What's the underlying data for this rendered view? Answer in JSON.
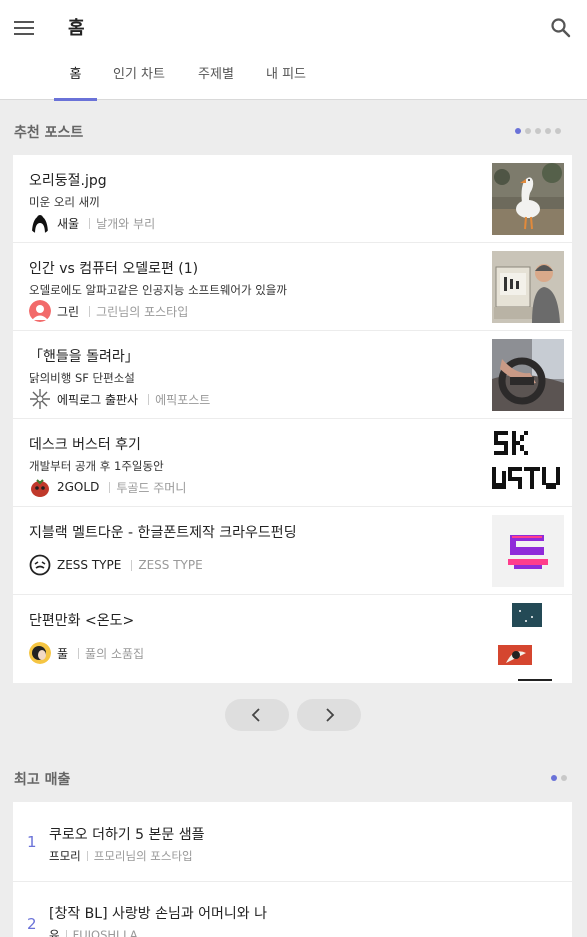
{
  "header": {
    "title": "홈",
    "menu_icon": "hamburger-menu-icon",
    "search_icon": "search-icon"
  },
  "tabs": [
    {
      "label": "홈",
      "active": true
    },
    {
      "label": "인기 차트",
      "active": false
    },
    {
      "label": "주제별",
      "active": false
    },
    {
      "label": "내 피드",
      "active": false
    }
  ],
  "recommended": {
    "heading": "추천 포스트",
    "page_count": 5,
    "current_page": 1,
    "posts": [
      {
        "title": "오리둥절.jpg",
        "subtitle": "미운 오리 새끼",
        "author": "새울",
        "magazine": "날개와 부리",
        "thumb": "duck-photo"
      },
      {
        "title": "인간 vs 컴퓨터 오델로편 (1)",
        "subtitle": "오델로에도 알파고같은 인공지능 소프트웨어가 있을까",
        "author": "그린",
        "magazine": "그린님의 포스타입",
        "thumb": "man-with-computer-photo"
      },
      {
        "title": "「핸들을 돌려라」",
        "subtitle": "닭의비행 SF 단편소설",
        "author": "에픽로그 출판사",
        "magazine": "에픽포스트",
        "thumb": "steering-wheel-photo"
      },
      {
        "title": "데스크 버스터 후기",
        "subtitle": "개발부터 공개 후 1주일동안",
        "author": "2GOLD",
        "magazine": "투골드 주머니",
        "thumb": "pixel-logo"
      },
      {
        "title": "지블랙 멜트다운 - 한글폰트제작 크라우드펀딩",
        "subtitle": "",
        "author": "ZESS TYPE",
        "magazine": "ZESS TYPE",
        "thumb": "font-glyph"
      },
      {
        "title": "단편만화 <온도>",
        "subtitle": "",
        "author": "풀",
        "magazine": "풀의 소품집",
        "thumb": "comic-panels"
      }
    ],
    "prev_icon": "chevron-left-icon",
    "next_icon": "chevron-right-icon"
  },
  "best_sellers": {
    "heading": "최고 매출",
    "page_count": 2,
    "current_page": 1,
    "items": [
      {
        "rank": "1",
        "title": "쿠로오 더하기 5 본문 샘플",
        "author": "프모리",
        "magazine": "프모리님의 포스타입"
      },
      {
        "rank": "2",
        "title": "[창작 BL] 사랑방 손님과 어머니와 나",
        "author": "유",
        "magazine": "FUJOSHI LA"
      }
    ]
  },
  "colors": {
    "accent": "#6a72d8",
    "background": "#ededed",
    "card": "#ffffff"
  }
}
